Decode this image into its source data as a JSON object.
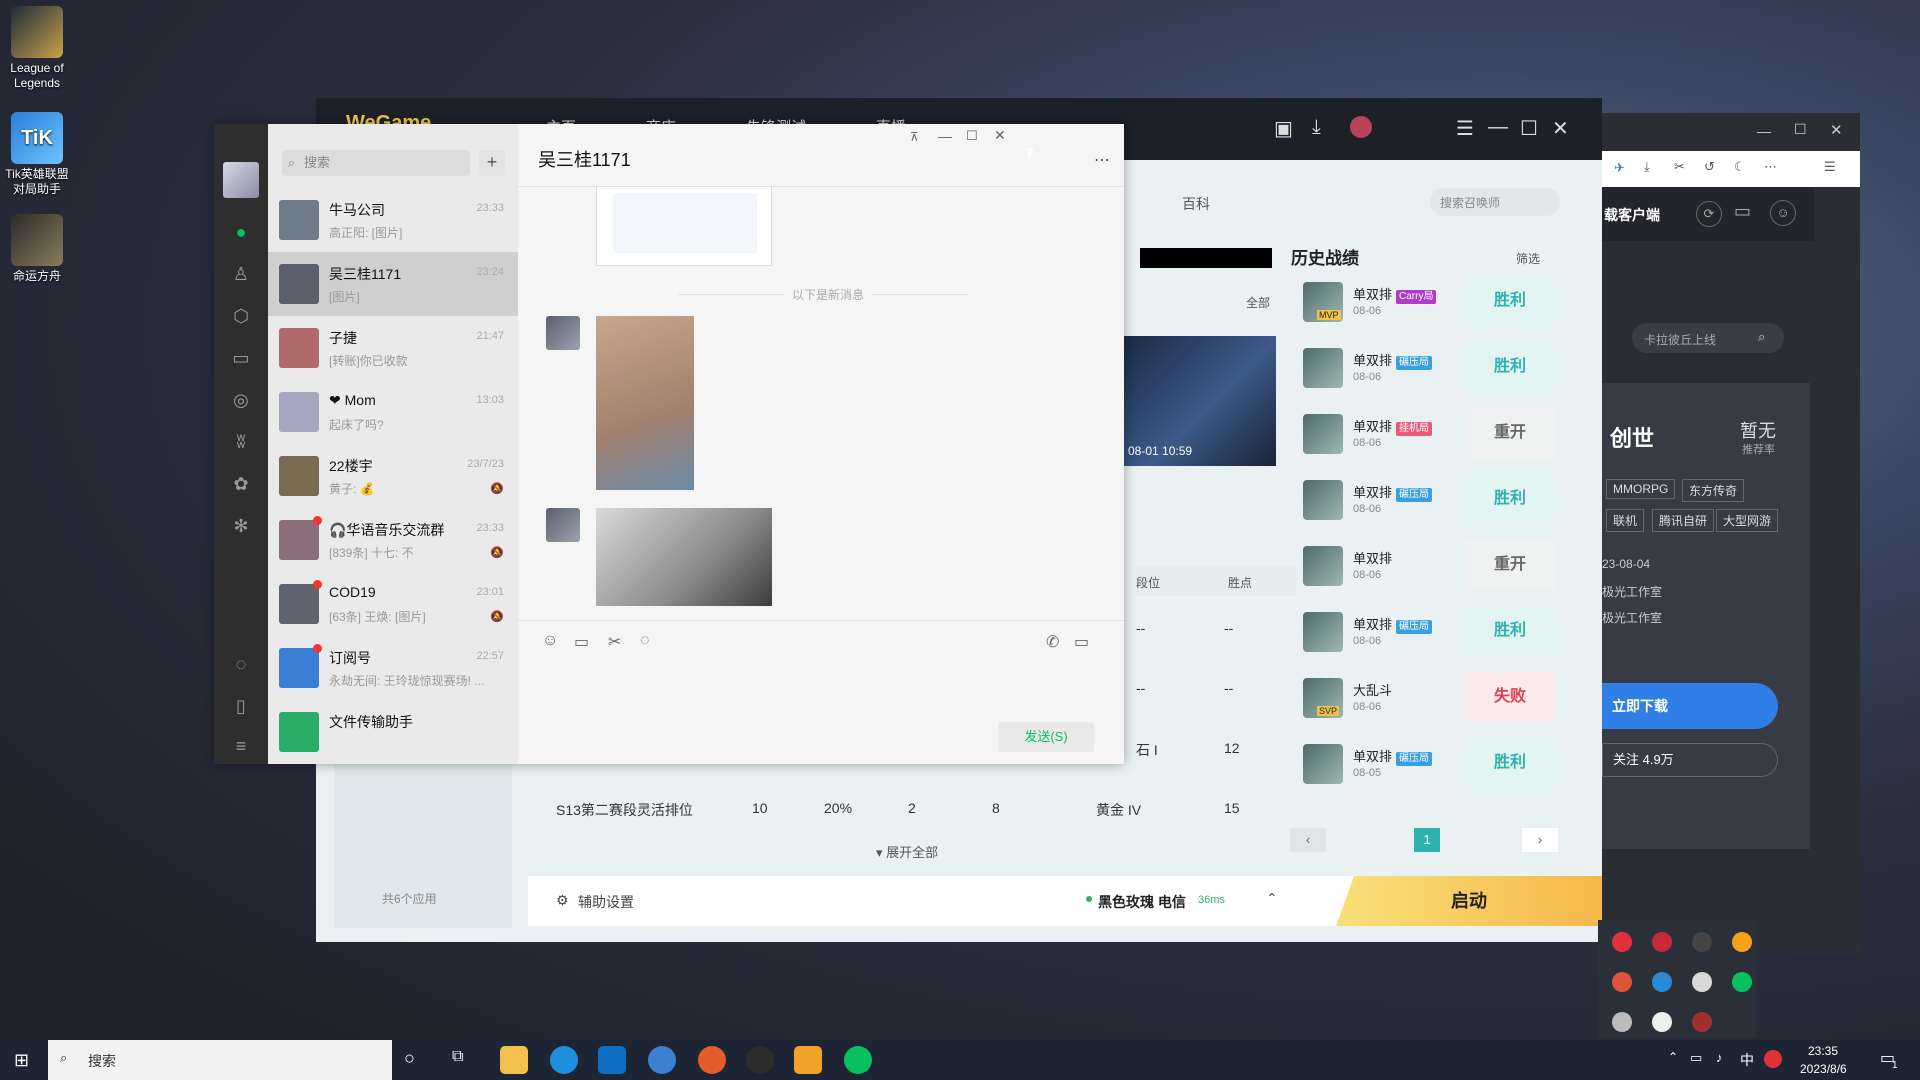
{
  "desktop": {
    "icons": [
      {
        "label": "League of Legends"
      },
      {
        "label": "Tik英雄联盟对局助手"
      },
      {
        "label": "命运方舟"
      }
    ]
  },
  "client": {
    "logo": "WeGame",
    "nav": [
      "主页",
      "商店",
      "先锋测试",
      "直播"
    ],
    "encyclopedia": "百科",
    "search_placeholder": "搜索召唤师",
    "all_label": "全部",
    "video_date": "08-01 10:59",
    "history": {
      "title": "历史战绩",
      "filter": "筛选",
      "items": [
        {
          "mode": "单双排",
          "tag": "Carry局",
          "tag_color": "#b03bc8",
          "date": "08-06",
          "result": "胜利",
          "cls": "win",
          "badge": "MVP"
        },
        {
          "mode": "单双排",
          "tag": "碾压局",
          "tag_color": "#3a9fe0",
          "date": "08-06",
          "result": "胜利",
          "cls": "win",
          "badge": ""
        },
        {
          "mode": "单双排",
          "tag": "挂机局",
          "tag_color": "#e85a7c",
          "date": "08-06",
          "result": "重开",
          "cls": "neutral",
          "badge": ""
        },
        {
          "mode": "单双排",
          "tag": "碾压局",
          "tag_color": "#3a9fe0",
          "date": "08-06",
          "result": "胜利",
          "cls": "win",
          "badge": ""
        },
        {
          "mode": "单双排",
          "tag": "",
          "tag_color": "",
          "date": "08-06",
          "result": "重开",
          "cls": "neutral",
          "badge": ""
        },
        {
          "mode": "单双排",
          "tag": "碾压局",
          "tag_color": "#3a9fe0",
          "date": "08-06",
          "result": "胜利",
          "cls": "win",
          "badge": ""
        },
        {
          "mode": "大乱斗",
          "tag": "",
          "tag_color": "",
          "date": "08-06",
          "result": "失败",
          "cls": "lose",
          "badge": "SVP"
        },
        {
          "mode": "单双排",
          "tag": "碾压局",
          "tag_color": "#3a9fe0",
          "date": "08-05",
          "result": "胜利",
          "cls": "win",
          "badge": ""
        }
      ],
      "page": "1"
    },
    "table": {
      "headers": [
        "段位",
        "胜点"
      ],
      "rows": [
        {
          "name": "",
          "a": "",
          "b": "",
          "c": "",
          "d": "",
          "rank": "--",
          "lp": "--"
        },
        {
          "name": "",
          "a": "",
          "b": "",
          "c": "",
          "d": "",
          "rank": "--",
          "lp": "--"
        },
        {
          "name": "",
          "a": "",
          "b": "",
          "c": "",
          "d": "",
          "rank": "石 I",
          "lp": "12"
        },
        {
          "name": "S13第二赛段灵活排位",
          "a": "10",
          "b": "20%",
          "c": "2",
          "d": "8",
          "rank": "黄金 IV",
          "lp": "15"
        }
      ],
      "expand": "展开全部"
    },
    "apps_count": "共6个应用",
    "assist": "辅助设置",
    "server": "黑色玫瑰 电信",
    "ping": "36ms",
    "launch": "启动"
  },
  "browser": {
    "client_label": "载客户端",
    "search_placeholder": "卡拉彼丘上线",
    "game_title": "创世",
    "rating": "暂无",
    "rating_label": "推荐率",
    "tags": [
      "MMORPG",
      "东方传奇",
      "联机",
      "腾讯自研",
      "大型网游"
    ],
    "date": "23-08-04",
    "studio1": "极光工作室",
    "studio2": "极光工作室",
    "download": "立即下载",
    "follow": "关注 4.9万"
  },
  "wechat": {
    "search_placeholder": "搜索",
    "title": "吴三桂1171",
    "new_messages": "以下是新消息",
    "send": "发送(S)",
    "chats": [
      {
        "name": "牛马公司",
        "time": "23:33",
        "preview": "高正阳: [图片]",
        "dot": false,
        "mute": false,
        "color": "#6e7b8a"
      },
      {
        "name": "吴三桂1171",
        "time": "23:24",
        "preview": "[图片]",
        "dot": false,
        "mute": false,
        "color": "#5a5f6b"
      },
      {
        "name": "子捷",
        "time": "21:47",
        "preview": "[转账]你已收款",
        "dot": false,
        "mute": false,
        "color": "#b06a6a"
      },
      {
        "name": "❤ Mom",
        "time": "13:03",
        "preview": "起床了吗?",
        "dot": false,
        "mute": false,
        "color": "#a6a6c0"
      },
      {
        "name": "22楼宇",
        "time": "23/7/23",
        "preview": "黄子: 💰",
        "dot": false,
        "mute": true,
        "color": "#7a6a52"
      },
      {
        "name": "🎧华语音乐交流群",
        "time": "23:33",
        "preview": "[839条] 十七: 不",
        "dot": true,
        "mute": true,
        "color": "#8a6f7a"
      },
      {
        "name": "COD19",
        "time": "23:01",
        "preview": "[63条] 王焕: [图片]",
        "dot": true,
        "mute": true,
        "color": "#5d6470"
      },
      {
        "name": "订阅号",
        "time": "22:57",
        "preview": "永劫无间: 王玲珑惊现赛场! ...",
        "dot": true,
        "mute": false,
        "color": "#3a7fd5"
      },
      {
        "name": "文件传输助手",
        "time": "",
        "preview": "",
        "dot": false,
        "mute": false,
        "color": "#2aae67"
      }
    ]
  },
  "taskbar": {
    "search_placeholder": "搜索",
    "time": "23:35",
    "date": "2023/8/6",
    "ime": "中",
    "notif": "1"
  }
}
